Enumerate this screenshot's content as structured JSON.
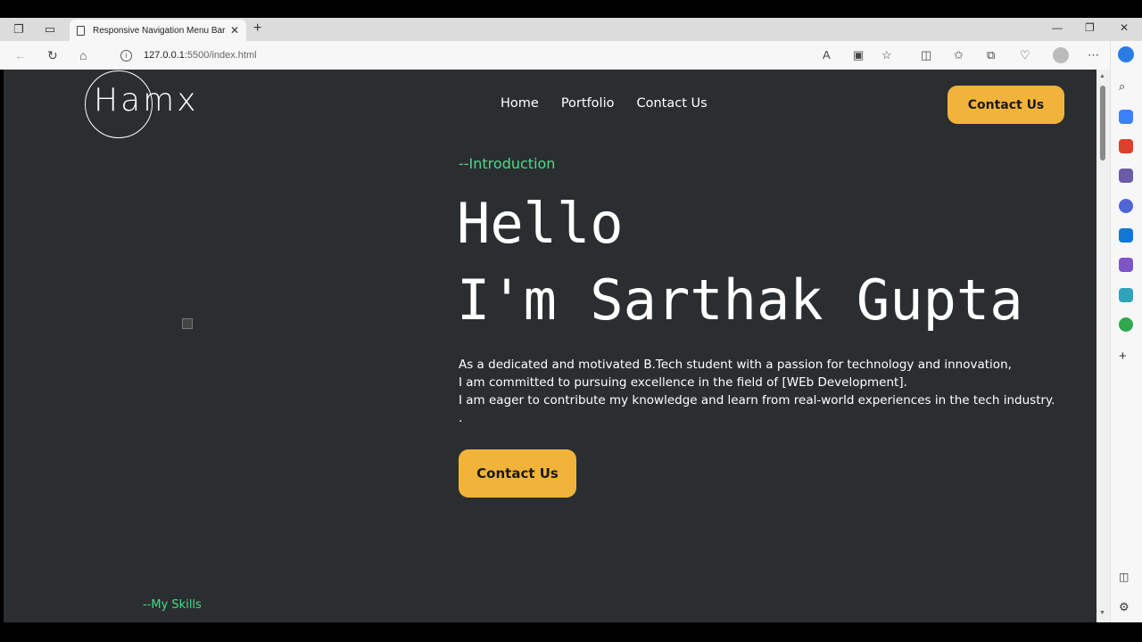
{
  "browser": {
    "tab_title": "Responsive Navigation Menu Bar",
    "url_host": "127.0.0.1",
    "url_path": ":5500/index.html"
  },
  "site": {
    "logo_text": "Hamx",
    "nav": [
      "Home",
      "Portfolio",
      "Contact Us"
    ],
    "header_button": "Contact Us",
    "intro_label": "--Introduction",
    "heading_line1": "Hello",
    "heading_line2": "I'm Sarthak Gupta",
    "paragraph": [
      "As a dedicated and motivated B.Tech student with a passion for technology and innovation,",
      "I am committed to pursuing excellence in the field of [WEb Development].",
      "I am eager to contribute my knowledge and learn from real-world experiences in the tech industry.",
      "."
    ],
    "hero_button": "Contact Us",
    "skills_label": "--My Skills"
  },
  "colors": {
    "page_bg": "#2b2e30",
    "accent_green": "#4cd98a",
    "button_yellow": "#f2b33a"
  }
}
